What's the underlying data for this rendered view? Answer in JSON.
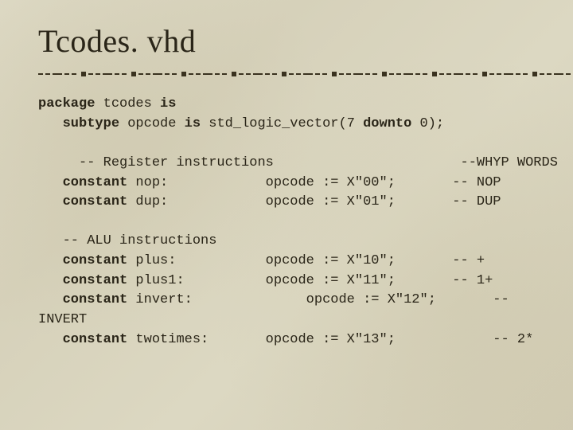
{
  "title": "Tcodes. vhd",
  "code": {
    "l1_kw1": "package",
    "l1_txt1": " tcodes ",
    "l1_kw2": "is",
    "l2_pad": "   ",
    "l2_kw1": "subtype",
    "l2_txt1": " opcode ",
    "l2_kw2": "is",
    "l2_txt2": " std_logic_vector(7 ",
    "l2_kw3": "downto",
    "l2_txt3": " 0);",
    "l3_txt": "     -- Register instructions                       --WHYP WORDS",
    "l4_pad": "   ",
    "l4_kw": "constant",
    "l4_txt": " nop:            opcode := X\"00\";       -- NOP",
    "l5_pad": "   ",
    "l5_kw": "constant",
    "l5_txt": " dup:            opcode := X\"01\";       -- DUP",
    "l6_txt": "   -- ALU instructions",
    "l7_pad": "   ",
    "l7_kw": "constant",
    "l7_txt": " plus:           opcode := X\"10\";       -- +",
    "l8_pad": "   ",
    "l8_kw": "constant",
    "l8_txt": " plus1:          opcode := X\"11\";       -- 1+",
    "l9_pad": "   ",
    "l9_kw": "constant",
    "l9_txt": " invert:              opcode := X\"12\";       --",
    "l10_txt": "INVERT",
    "l11_pad": "   ",
    "l11_kw": "constant",
    "l11_txt": " twotimes:       opcode := X\"13\";            -- 2*"
  }
}
